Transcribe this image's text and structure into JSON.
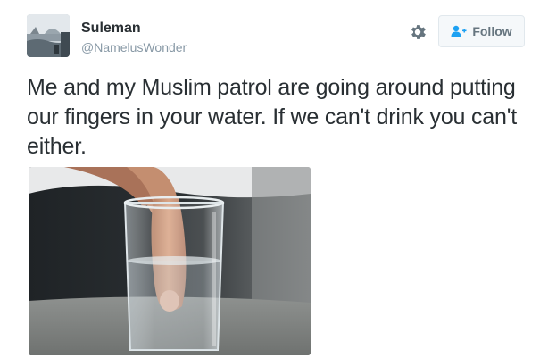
{
  "user": {
    "display_name": "Suleman",
    "handle": "@NamelusWonder"
  },
  "actions": {
    "settings_icon": "gear-icon",
    "follow_icon": "add-user-icon",
    "follow_label": "Follow"
  },
  "tweet": {
    "text": "Me and my Muslim patrol are going around putting our fingers in your water. If we can't drink you can't either."
  },
  "colors": {
    "text": "#292f33",
    "secondary_text": "#8899a6",
    "follow_text": "#66757f",
    "follow_bg": "#f5f8fa",
    "follow_border": "#e1e8ed",
    "link_blue": "#1da1f2"
  }
}
